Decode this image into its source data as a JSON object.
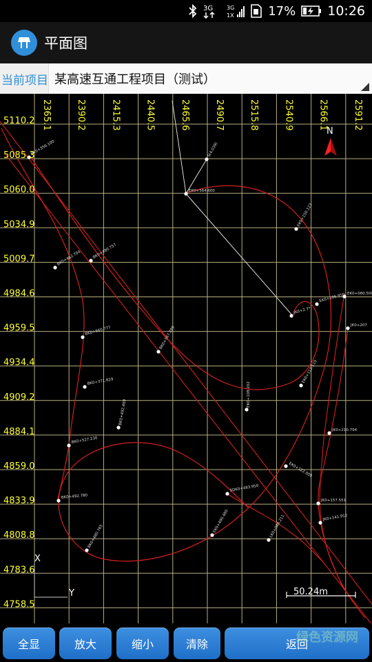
{
  "status_bar": {
    "battery_percent": "17%",
    "time": "10:26",
    "icons": [
      "bluetooth-icon",
      "3g-signal-icon",
      "signal-icon",
      "sim-icon",
      "battery-charging-icon"
    ]
  },
  "app_bar": {
    "title": "平面图",
    "icon": "app-logo-icon"
  },
  "project_bar": {
    "label": "当前项目",
    "value": "某高速互通工程项目（测试）"
  },
  "plot": {
    "x_ticks": [
      "2365.1",
      "2390.2",
      "2415.3",
      "2440.5",
      "2465.6",
      "2490.7",
      "2515.8",
      "2540.9",
      "2566.1",
      "2591.2"
    ],
    "y_ticks": [
      "5110.2",
      "5085.3",
      "5060.0",
      "5034.9",
      "5009.7",
      "4984.6",
      "4959.5",
      "4934.4",
      "4909.2",
      "4884.1",
      "4859.0",
      "4833.9",
      "4808.8",
      "4783.6",
      "4758.5"
    ],
    "north_label": "N",
    "axis_x_label": "X",
    "axis_y_label": "Y",
    "scale_text": "50.24m",
    "colors": {
      "grid": "#b8b080",
      "tick_text": "#ffff33",
      "curve": "#d42020",
      "point": "#ffffff",
      "north": "#ff2020"
    },
    "point_labels": [
      "BK0+356.100",
      "BK0+462.704",
      "BK0+480.757",
      "BK0+660.777",
      "BK0+567.286",
      "BK0+371.829",
      "BK0+492.469",
      "BK0+527.230",
      "BK0+492.780",
      "BK0+480.765",
      "SDK0+483.950",
      "EK0+490.480",
      "EK0+564.600",
      "S(4.039)",
      "EK0+108.202",
      "EK0+113.110",
      "EK0+105.950",
      "JK0+2.7*",
      "JK0+207",
      "JK0+210.794",
      "JK0+157.551",
      "JK0+141.912",
      "EK0+122.000",
      "LK0+088.211",
      "EK0+150.123",
      "EK0+080.500"
    ]
  },
  "buttons": {
    "full": "全显",
    "zoom_in": "放大",
    "zoom_out": "缩小",
    "clear": "清除",
    "back": "返回"
  },
  "watermark": "绿色资源网"
}
